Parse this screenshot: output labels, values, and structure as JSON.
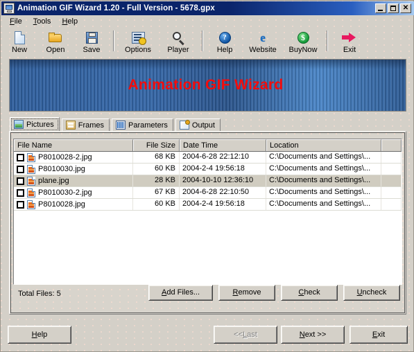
{
  "window": {
    "title": "Animation GIF Wizard 1.20 - Full Version - 5678.gpx",
    "app_icon": "monitor-icon",
    "minimize_label": "Minimize",
    "maximize_label": "Maximize",
    "close_label": "Close",
    "close_glyph": "✕"
  },
  "menu": [
    {
      "label": "File",
      "mnemonic": "F"
    },
    {
      "label": "Tools",
      "mnemonic": "T"
    },
    {
      "label": "Help",
      "mnemonic": "H"
    }
  ],
  "toolbar": {
    "buttons": [
      {
        "label": "New",
        "icon": "new-document-icon"
      },
      {
        "label": "Open",
        "icon": "open-folder-icon"
      },
      {
        "label": "Save",
        "icon": "save-floppy-icon"
      },
      {
        "label": "Options",
        "icon": "options-gear-icon"
      },
      {
        "label": "Player",
        "icon": "player-magnifier-icon"
      },
      {
        "label": "Help",
        "icon": "help-question-icon",
        "glyph": "?"
      },
      {
        "label": "Website",
        "icon": "internet-explorer-icon",
        "glyph": "e"
      },
      {
        "label": "BuyNow",
        "icon": "dollar-coin-icon",
        "glyph": "$"
      },
      {
        "label": "Exit",
        "icon": "exit-arrow-icon"
      }
    ]
  },
  "banner": {
    "text": "Animation GIF Wizard",
    "text_color": "#f40c0c",
    "background_color": "#3567a8"
  },
  "tabs": [
    {
      "label": "Pictures",
      "icon": "pictures-image-icon",
      "active": true
    },
    {
      "label": "Frames",
      "icon": "frames-film-icon",
      "active": false
    },
    {
      "label": "Parameters",
      "icon": "parameters-grid-icon",
      "active": false
    },
    {
      "label": "Output",
      "icon": "output-page-icon",
      "active": false
    }
  ],
  "filelist": {
    "columns": [
      "File Name",
      "File Size",
      "Date Time",
      "Location",
      ""
    ],
    "rows": [
      {
        "checked": false,
        "icon": "image-file-icon",
        "name": "P8010028-2.jpg",
        "size": "68 KB",
        "datetime": "2004-6-28 22:12:10",
        "location": "C:\\Documents and Settings\\...",
        "selected": false
      },
      {
        "checked": false,
        "icon": "image-file-icon",
        "name": "P8010030.jpg",
        "size": "60 KB",
        "datetime": "2004-2-4 19:56:18",
        "location": "C:\\Documents and Settings\\...",
        "selected": false
      },
      {
        "checked": false,
        "icon": "image-file-icon",
        "name": "plane.jpg",
        "size": "28 KB",
        "datetime": "2004-10-10 12:36:10",
        "location": "C:\\Documents and Settings\\...",
        "selected": true
      },
      {
        "checked": false,
        "icon": "image-file-icon",
        "name": "P8010030-2.jpg",
        "size": "67 KB",
        "datetime": "2004-6-28 22:10:50",
        "location": "C:\\Documents and Settings\\...",
        "selected": false
      },
      {
        "checked": false,
        "icon": "image-file-icon",
        "name": "P8010028.jpg",
        "size": "60 KB",
        "datetime": "2004-2-4 19:56:18",
        "location": "C:\\Documents and Settings\\...",
        "selected": false
      }
    ]
  },
  "status": {
    "total_files": "Total Files: 5"
  },
  "panel_buttons": {
    "add_files": {
      "pre": "A",
      "post": "dd Files..."
    },
    "remove": {
      "pre": "R",
      "post": "emove"
    },
    "check": {
      "pre": "C",
      "post": "heck"
    },
    "uncheck": {
      "pre": "U",
      "post": "ncheck"
    }
  },
  "nav_buttons": {
    "help": {
      "pre": "H",
      "post": "elp",
      "disabled": false
    },
    "last": {
      "lead": "<< ",
      "pre": "L",
      "post": "ast",
      "disabled": true
    },
    "next": {
      "pre": "N",
      "post": "ext >>",
      "disabled": false
    },
    "exit": {
      "pre": "E",
      "post": "xit",
      "disabled": false
    }
  }
}
